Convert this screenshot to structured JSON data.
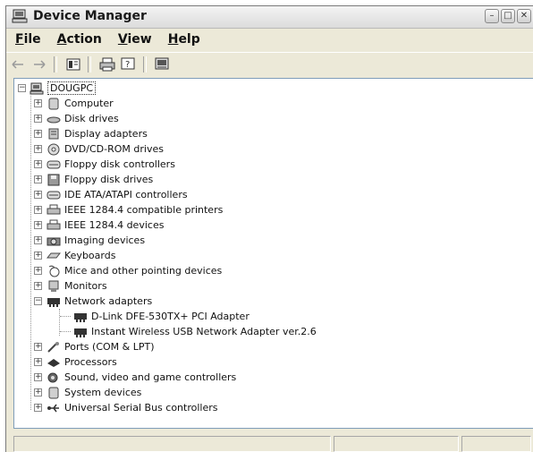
{
  "window": {
    "title": "Device Manager"
  },
  "menu": [
    {
      "label": "File",
      "ul": "F",
      "rest": "ile"
    },
    {
      "label": "Action",
      "ul": "A",
      "rest": "ction"
    },
    {
      "label": "View",
      "ul": "V",
      "rest": "iew"
    },
    {
      "label": "Help",
      "ul": "H",
      "rest": "elp"
    }
  ],
  "toolbar": [
    "back-arrow-icon",
    "forward-arrow-icon",
    "properties-icon",
    "print-icon",
    "help-icon",
    "scan-hardware-icon"
  ],
  "tree": {
    "root": "DOUGPC",
    "categories": [
      {
        "label": "Computer",
        "icon": "computer-icon",
        "expanded": false
      },
      {
        "label": "Disk drives",
        "icon": "disk-drive-icon",
        "expanded": false
      },
      {
        "label": "Display adapters",
        "icon": "display-adapter-icon",
        "expanded": false
      },
      {
        "label": "DVD/CD-ROM drives",
        "icon": "cd-drive-icon",
        "expanded": false
      },
      {
        "label": "Floppy disk controllers",
        "icon": "controller-icon",
        "expanded": false
      },
      {
        "label": "Floppy disk drives",
        "icon": "floppy-icon",
        "expanded": false
      },
      {
        "label": "IDE ATA/ATAPI controllers",
        "icon": "controller-icon",
        "expanded": false
      },
      {
        "label": "IEEE 1284.4 compatible printers",
        "icon": "printer-icon",
        "expanded": false
      },
      {
        "label": "IEEE 1284.4 devices",
        "icon": "printer-icon",
        "expanded": false
      },
      {
        "label": "Imaging devices",
        "icon": "camera-icon",
        "expanded": false
      },
      {
        "label": "Keyboards",
        "icon": "keyboard-icon",
        "expanded": false
      },
      {
        "label": "Mice and other pointing devices",
        "icon": "mouse-icon",
        "expanded": false
      },
      {
        "label": "Monitors",
        "icon": "monitor-icon",
        "expanded": false
      },
      {
        "label": "Network adapters",
        "icon": "network-adapter-icon",
        "expanded": true,
        "children": [
          "D-Link DFE-530TX+ PCI Adapter",
          "Instant Wireless USB Network Adapter ver.2.6"
        ]
      },
      {
        "label": "Ports (COM & LPT)",
        "icon": "port-icon",
        "expanded": false
      },
      {
        "label": "Processors",
        "icon": "processor-icon",
        "expanded": false
      },
      {
        "label": "Sound, video and game controllers",
        "icon": "sound-icon",
        "expanded": false
      },
      {
        "label": "System devices",
        "icon": "system-icon",
        "expanded": false
      },
      {
        "label": "Universal Serial Bus controllers",
        "icon": "usb-icon",
        "expanded": false
      }
    ]
  },
  "colors": {
    "window_bg": "#ece9d8",
    "tree_bg": "#ffffff",
    "border": "#7f9db9"
  }
}
